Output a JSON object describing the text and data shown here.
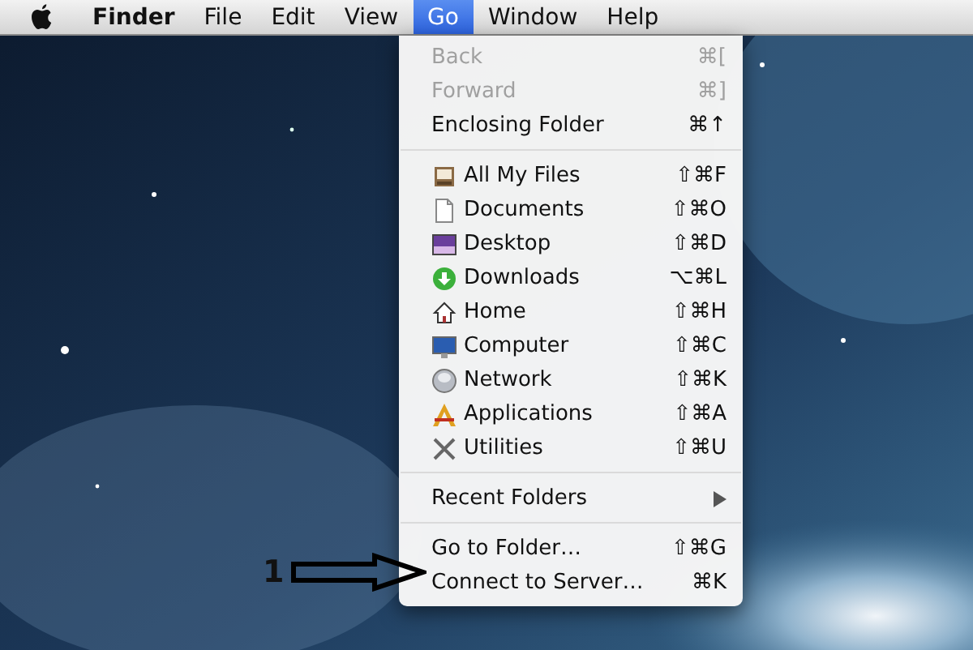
{
  "menu_bar": {
    "items": [
      {
        "label": "Finder",
        "selected": false,
        "bold": true
      },
      {
        "label": "File",
        "selected": false,
        "bold": false
      },
      {
        "label": "Edit",
        "selected": false,
        "bold": false
      },
      {
        "label": "View",
        "selected": false,
        "bold": false
      },
      {
        "label": "Go",
        "selected": true,
        "bold": false
      },
      {
        "label": "Window",
        "selected": false,
        "bold": false
      },
      {
        "label": "Help",
        "selected": false,
        "bold": false
      }
    ]
  },
  "go_menu": {
    "sections": [
      [
        {
          "kind": "plain",
          "label": "Back",
          "shortcut": "⌘[",
          "disabled": true
        },
        {
          "kind": "plain",
          "label": "Forward",
          "shortcut": "⌘]",
          "disabled": true
        },
        {
          "kind": "plain",
          "label": "Enclosing Folder",
          "shortcut": "⌘↑",
          "disabled": false
        }
      ],
      [
        {
          "kind": "icon",
          "label": "All My Files",
          "shortcut": "⇧⌘F",
          "disabled": false
        },
        {
          "kind": "icon",
          "label": "Documents",
          "shortcut": "⇧⌘O",
          "disabled": false
        },
        {
          "kind": "icon",
          "label": "Desktop",
          "shortcut": "⇧⌘D",
          "disabled": false
        },
        {
          "kind": "icon",
          "label": "Downloads",
          "shortcut": "⌥⌘L",
          "disabled": false
        },
        {
          "kind": "icon",
          "label": "Home",
          "shortcut": "⇧⌘H",
          "disabled": false
        },
        {
          "kind": "icon",
          "label": "Computer",
          "shortcut": "⇧⌘C",
          "disabled": false
        },
        {
          "kind": "icon",
          "label": "Network",
          "shortcut": "⇧⌘K",
          "disabled": false
        },
        {
          "kind": "icon",
          "label": "Applications",
          "shortcut": "⇧⌘A",
          "disabled": false
        },
        {
          "kind": "icon",
          "label": "Utilities",
          "shortcut": "⇧⌘U",
          "disabled": false
        }
      ],
      [
        {
          "kind": "submenu",
          "label": "Recent Folders",
          "disabled": false
        }
      ],
      [
        {
          "kind": "plain",
          "label": "Go to Folder…",
          "shortcut": "⇧⌘G",
          "disabled": false
        },
        {
          "kind": "plain",
          "label": "Connect to Server…",
          "shortcut": "⌘K",
          "disabled": false
        }
      ]
    ]
  },
  "annotation": {
    "label": "1"
  }
}
